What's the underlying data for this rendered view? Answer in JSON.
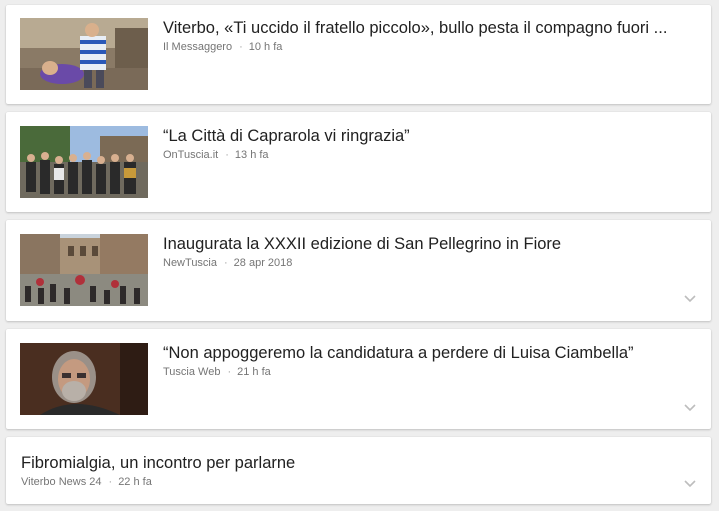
{
  "stories": [
    {
      "title": "Viterbo, «Ti uccido il fratello piccolo», bullo pesta il compagno fuori ...",
      "source": "Il Messaggero",
      "time": "10 h fa",
      "thumbnail_icon": "photo-boys-fighting"
    },
    {
      "title": "“La Città di Caprarola vi ringrazia”",
      "source": "OnTuscia.it",
      "time": "13 h fa",
      "thumbnail_icon": "photo-group-outdoor"
    },
    {
      "title": "Inaugurata la XXXII edizione di San Pellegrino in Fiore",
      "source": "NewTuscia",
      "time": "28 apr 2018",
      "thumbnail_icon": "photo-town-square-crowd"
    },
    {
      "title": "“Non appoggeremo la candidatura a perdere di Luisa Ciambella”",
      "source": "Tuscia Web",
      "time": "21 h fa",
      "thumbnail_icon": "photo-portrait-man"
    },
    {
      "title": "Fibromialgia, un incontro per parlarne",
      "source": "Viterbo News 24",
      "time": "22 h fa"
    }
  ],
  "separator": "·"
}
